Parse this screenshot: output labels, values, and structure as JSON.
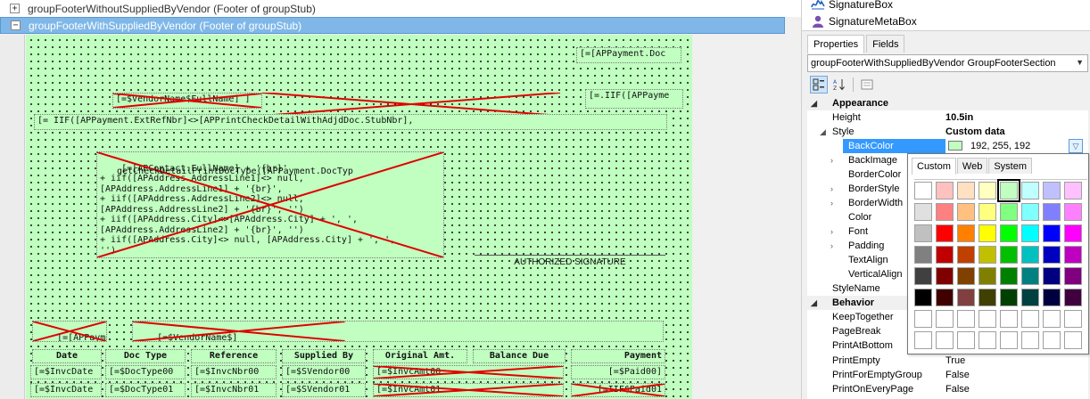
{
  "designer": {
    "sections": [
      {
        "title": "groupFooterWithoutSuppliedByVendor (Footer of groupStub)",
        "toggle": "+"
      },
      {
        "title": "groupFooterWithSuppliedByVendor (Footer of groupStub)",
        "toggle": "−"
      }
    ],
    "fields": {
      "f_apdoc": "[=[APPayment.Doc",
      "f_vendorname": "[=$VendorName$FullName] ]",
      "f_iif1": "[=.IIF([APPayme",
      "f_extref": "[= IIF([APPayment.ExtRefNbr]<>[APPrintCheckDetailWithAdjdDoc.StubNbr],",
      "f_address": "[=[APContact.FullName] + '{br}'\n+ iif([APAddress.AddressLine1]<> null,\n[APAddress.AddressLine1] + '{br}',\n+ iif([APAddress.AddressLine2]<> null,\n[APAddress.AddressLine2] + '{br}', '')\n+ iif([APAddress.City]<>[APAddress.City] + ', ',\n[APAddress.AddressLine2] + '{br}', '')\n+ iif([APAddress.City]<> null, [APAddress.City] + ', ',\n'')",
      "f_overlap": "getCheckDetailPrintDocType([APPayment.DocTyp",
      "f_sig": "AUTHORIZED SIGNATURE",
      "f_app": "[=[APPaymen",
      "f_vendor2": "[=$VendorName$]\n[=[APContact.FullName] ]"
    },
    "table": {
      "headers": [
        "Date",
        "Doc Type",
        "Reference",
        "Supplied By",
        "Original Amt.",
        "Balance Due",
        "Payment"
      ],
      "rows": [
        [
          "[=$InvcDate",
          "[=$DocType00",
          "[=$InvcNbr00",
          "[=$SVendor00",
          "[=$InvcAmt00",
          "[=$InvcBal00",
          "[=$Paid00]"
        ],
        [
          "[=$InvcDate",
          "[=$DocType01",
          "[=$InvcNbr01",
          "[=$SVendor01",
          "[=$InvcAmt01",
          "[=$InvcBal01",
          "[=IIF$Paid01"
        ]
      ]
    }
  },
  "toolbox": {
    "items": [
      {
        "label": "SignatureBox",
        "icon": "signature-icon"
      },
      {
        "label": "SignatureMetaBox",
        "icon": "person-icon"
      }
    ]
  },
  "panel": {
    "tabs": [
      "Properties",
      "Fields"
    ],
    "object_selector": "groupFooterWithSuppliedByVendor  GroupFooterSection",
    "toolbar": {
      "categorized": "⊞",
      "alpha": "A↓Z",
      "pages": "▤"
    },
    "properties": [
      {
        "type": "cat",
        "name": "Appearance",
        "toggle": "◢"
      },
      {
        "type": "prop",
        "name": "Height",
        "value": "10.5in",
        "bold": true
      },
      {
        "type": "prop",
        "name": "Style",
        "value": "Custom data",
        "bold": true,
        "toggle": "◢"
      },
      {
        "type": "sel",
        "name": "BackColor",
        "value": "192, 255, 192"
      },
      {
        "type": "sub",
        "name": "BackImage",
        "toggle": "›"
      },
      {
        "type": "sub",
        "name": "BorderColor",
        "toggle": ""
      },
      {
        "type": "sub",
        "name": "BorderStyle",
        "toggle": "›"
      },
      {
        "type": "sub",
        "name": "BorderWidth",
        "toggle": "›"
      },
      {
        "type": "sub",
        "name": "Color",
        "toggle": ""
      },
      {
        "type": "sub",
        "name": "Font",
        "toggle": "›"
      },
      {
        "type": "sub",
        "name": "Padding",
        "toggle": "›"
      },
      {
        "type": "sub",
        "name": "TextAlign",
        "toggle": ""
      },
      {
        "type": "sub",
        "name": "VerticalAlign",
        "toggle": ""
      },
      {
        "type": "prop",
        "name": "StyleName",
        "value": ""
      },
      {
        "type": "cat",
        "name": "Behavior",
        "toggle": "◢"
      },
      {
        "type": "prop",
        "name": "KeepTogether",
        "value": ""
      },
      {
        "type": "prop",
        "name": "PageBreak",
        "value": ""
      },
      {
        "type": "prop",
        "name": "PrintAtBottom",
        "value": ""
      },
      {
        "type": "prop",
        "name": "PrintEmpty",
        "value": "True"
      },
      {
        "type": "prop",
        "name": "PrintForEmptyGroup",
        "value": "False"
      },
      {
        "type": "prop",
        "name": "PrintOnEveryPage",
        "value": "False"
      }
    ]
  },
  "picker": {
    "tabs": [
      "Custom",
      "Web",
      "System"
    ],
    "selected": "#c0ffc0",
    "colors": [
      [
        "#ffffff",
        "#ffc0c0",
        "#ffe0c0",
        "#ffffc0",
        "#c0ffc0",
        "#c0ffff",
        "#c0c0ff",
        "#ffc0ff"
      ],
      [
        "#e0e0e0",
        "#ff8080",
        "#ffc080",
        "#ffff80",
        "#80ff80",
        "#80ffff",
        "#8080ff",
        "#ff80ff"
      ],
      [
        "#c0c0c0",
        "#ff0000",
        "#ff8000",
        "#ffff00",
        "#00ff00",
        "#00ffff",
        "#0000ff",
        "#ff00ff"
      ],
      [
        "#808080",
        "#c00000",
        "#c04000",
        "#c0c000",
        "#00c000",
        "#00c0c0",
        "#0000c0",
        "#c000c0"
      ],
      [
        "#404040",
        "#800000",
        "#804000",
        "#808000",
        "#008000",
        "#008080",
        "#000080",
        "#800080"
      ],
      [
        "#000000",
        "#400000",
        "#804040",
        "#404000",
        "#004000",
        "#004040",
        "#000040",
        "#400040"
      ],
      [
        "#ffffff",
        "#ffffff",
        "#ffffff",
        "#ffffff",
        "#ffffff",
        "#ffffff",
        "#ffffff",
        "#ffffff"
      ],
      [
        "#ffffff",
        "#ffffff",
        "#ffffff",
        "#ffffff",
        "#ffffff",
        "#ffffff",
        "#ffffff",
        "#ffffff"
      ]
    ]
  }
}
